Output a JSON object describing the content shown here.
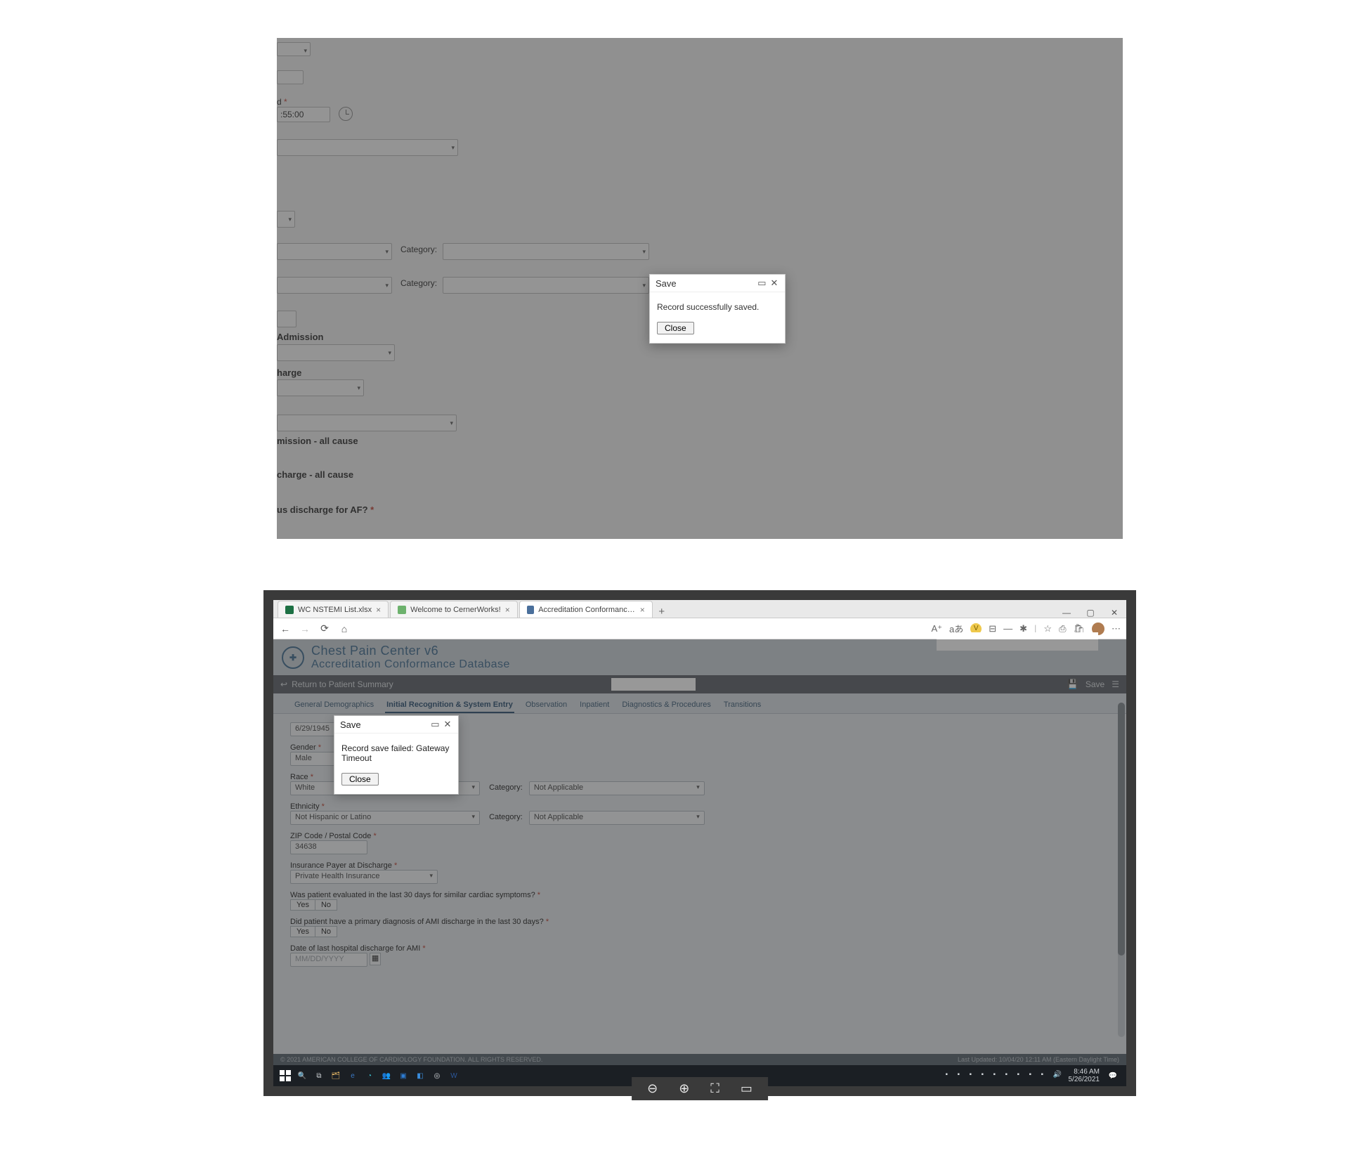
{
  "shot1": {
    "modal": {
      "title": "Save",
      "body": "Record successfully saved.",
      "close_label": "Close"
    },
    "form": {
      "time_value": ":55:00",
      "category_label": "Category:",
      "admission_label": "Admission",
      "discharge_label": "harge",
      "admission_allcause_label": "mission - all cause",
      "discharge_allcause_label": "charge - all cause",
      "af_discharge_label": "us discharge for AF?"
    }
  },
  "shot2": {
    "tabs": [
      {
        "label": "WC NSTEMI List.xlsx",
        "favicon": "excel"
      },
      {
        "label": "Welcome to CernerWorks!",
        "favicon": "green"
      },
      {
        "label": "Accreditation Conformance Data",
        "favicon": "acc",
        "active": true
      }
    ],
    "app_title1": "Chest Pain Center v6",
    "app_title2": "Accreditation Conformance Database",
    "return_label": "Return to Patient Summary",
    "save_label": "Save",
    "nav_tabs": [
      "General Demographics",
      "Initial Recognition & System Entry",
      "Observation",
      "Inpatient",
      "Diagnostics & Procedures",
      "Transitions"
    ],
    "nav_active_index": 1,
    "form": {
      "dob_value": "6/29/1945",
      "gender_label": "Gender",
      "gender_value": "Male",
      "race_label": "Race",
      "race_value": "White",
      "race_cat_value": "Not Applicable",
      "ethnicity_label": "Ethnicity",
      "ethnicity_value": "Not Hispanic or Latino",
      "ethnicity_cat_value": "Not Applicable",
      "category_label": "Category:",
      "zip_label": "ZIP Code / Postal Code",
      "zip_value": "34638",
      "payer_label": "Insurance Payer at Discharge",
      "payer_value": "Private Health Insurance",
      "q30_label": "Was patient evaluated in the last 30 days for similar cardiac symptoms?",
      "ami30_label": "Did patient have a primary diagnosis of AMI discharge in the last 30 days?",
      "last_ami_label": "Date of last hospital discharge for AMI",
      "last_ami_placeholder": "MM/DD/YYYY",
      "yes": "Yes",
      "no": "No"
    },
    "modal": {
      "title": "Save",
      "body": "Record save failed: Gateway Timeout",
      "close_label": "Close"
    },
    "footer_left": "© 2021 AMERICAN COLLEGE OF CARDIOLOGY FOUNDATION. ALL RIGHTS RESERVED.",
    "footer_right": "Last Updated: 10/04/20 12:11 AM (Eastern Daylight Time)",
    "clock_time": "8:46 AM",
    "clock_date": "5/26/2021"
  },
  "viewer_tools": [
    "zoom-out",
    "zoom-in",
    "fullscreen",
    "present"
  ]
}
